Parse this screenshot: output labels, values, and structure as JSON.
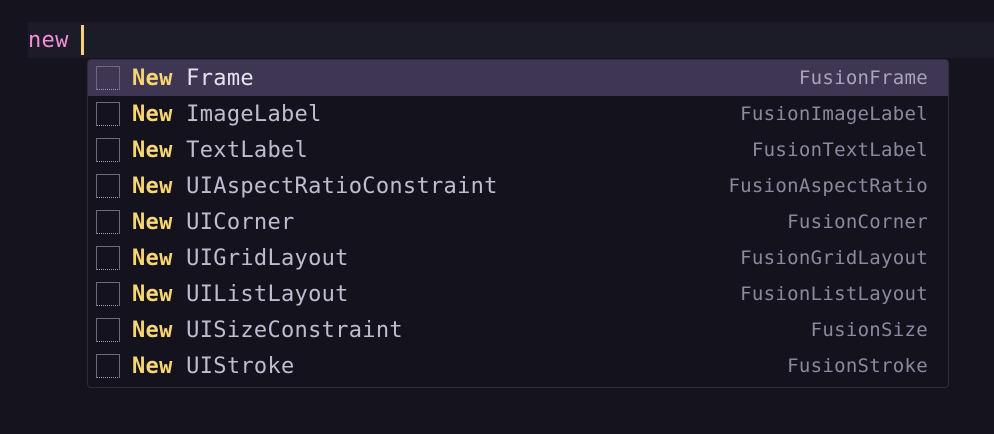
{
  "editor": {
    "typed_text": "new",
    "colors": {
      "background": "#15141e",
      "keyword": "#f28fd6",
      "cursor": "#f5d27a",
      "match": "#f7d774",
      "selection": "#3e3653"
    }
  },
  "completion": {
    "selected_index": 0,
    "item_icon": "class-box-icon",
    "items": [
      {
        "match": "New",
        "rest": " Frame",
        "detail": "FusionFrame"
      },
      {
        "match": "New",
        "rest": " ImageLabel",
        "detail": "FusionImageLabel"
      },
      {
        "match": "New",
        "rest": " TextLabel",
        "detail": "FusionTextLabel"
      },
      {
        "match": "New",
        "rest": " UIAspectRatioConstraint",
        "detail": "FusionAspectRatio"
      },
      {
        "match": "New",
        "rest": " UICorner",
        "detail": "FusionCorner"
      },
      {
        "match": "New",
        "rest": " UIGridLayout",
        "detail": "FusionGridLayout"
      },
      {
        "match": "New",
        "rest": " UIListLayout",
        "detail": "FusionListLayout"
      },
      {
        "match": "New",
        "rest": " UISizeConstraint",
        "detail": "FusionSize"
      },
      {
        "match": "New",
        "rest": " UIStroke",
        "detail": "FusionStroke"
      }
    ]
  }
}
